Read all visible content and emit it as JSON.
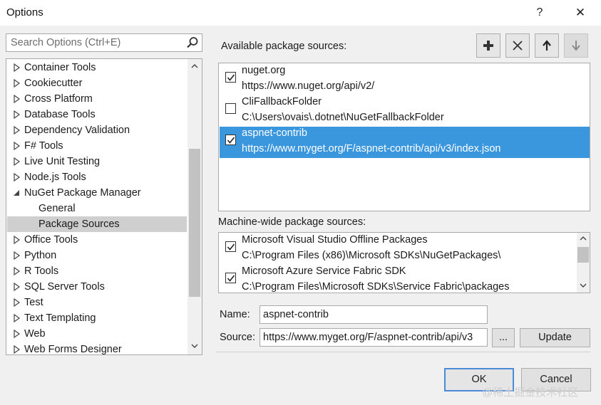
{
  "window": {
    "title": "Options",
    "help_glyph": "?",
    "close_glyph": "✕"
  },
  "search": {
    "placeholder": "Search Options (Ctrl+E)"
  },
  "tree": {
    "items": [
      {
        "label": "Container Tools",
        "state": "collapsed"
      },
      {
        "label": "Cookiecutter",
        "state": "collapsed"
      },
      {
        "label": "Cross Platform",
        "state": "collapsed"
      },
      {
        "label": "Database Tools",
        "state": "collapsed"
      },
      {
        "label": "Dependency Validation",
        "state": "collapsed"
      },
      {
        "label": "F# Tools",
        "state": "collapsed"
      },
      {
        "label": "Live Unit Testing",
        "state": "collapsed"
      },
      {
        "label": "Node.js Tools",
        "state": "collapsed"
      },
      {
        "label": "NuGet Package Manager",
        "state": "expanded"
      },
      {
        "label": "General",
        "state": "child"
      },
      {
        "label": "Package Sources",
        "state": "child-selected"
      },
      {
        "label": "Office Tools",
        "state": "collapsed"
      },
      {
        "label": "Python",
        "state": "collapsed"
      },
      {
        "label": "R Tools",
        "state": "collapsed"
      },
      {
        "label": "SQL Server Tools",
        "state": "collapsed"
      },
      {
        "label": "Test",
        "state": "collapsed"
      },
      {
        "label": "Text Templating",
        "state": "collapsed"
      },
      {
        "label": "Web",
        "state": "collapsed"
      },
      {
        "label": "Web Forms Designer",
        "state": "collapsed"
      }
    ]
  },
  "available": {
    "label": "Available package sources:",
    "sources": [
      {
        "name": "nuget.org",
        "url": "https://www.nuget.org/api/v2/",
        "checked": true,
        "selected": false
      },
      {
        "name": "CliFallbackFolder",
        "url": "C:\\Users\\ovais\\.dotnet\\NuGetFallbackFolder",
        "checked": false,
        "selected": false
      },
      {
        "name": "aspnet-contrib",
        "url": "https://www.myget.org/F/aspnet-contrib/api/v3/index.json",
        "checked": true,
        "selected": true
      }
    ]
  },
  "toolbar": {
    "add_icon": "plus-icon",
    "remove_icon": "x-icon",
    "up_icon": "arrow-up-icon",
    "down_icon": "arrow-down-icon"
  },
  "machine": {
    "label": "Machine-wide package sources:",
    "sources": [
      {
        "name": "Microsoft Visual Studio Offline Packages",
        "url": "C:\\Program Files (x86)\\Microsoft SDKs\\NuGetPackages\\",
        "checked": true
      },
      {
        "name": "Microsoft Azure Service Fabric SDK",
        "url": "C:\\Program Files\\Microsoft SDKs\\Service Fabric\\packages",
        "checked": true
      }
    ]
  },
  "form": {
    "name_label": "Name:",
    "name_value": "aspnet-contrib",
    "source_label": "Source:",
    "source_value": "https://www.myget.org/F/aspnet-contrib/api/v3",
    "browse_label": "...",
    "update_label": "Update"
  },
  "buttons": {
    "ok": "OK",
    "cancel": "Cancel"
  },
  "watermark": "@稀土掘金技术社区",
  "colors": {
    "selection": "#3a96dd",
    "tree_selection": "#cfcfcf",
    "default_border": "#4a8ad6"
  }
}
